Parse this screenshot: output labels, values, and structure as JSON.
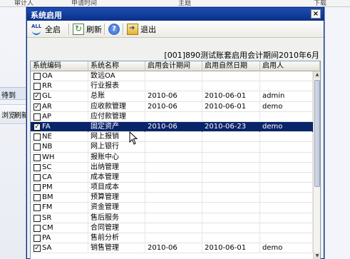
{
  "background": {
    "top_row": [
      "审计人",
      "申请时间",
      "主题",
      "下载"
    ],
    "side_tab": "待到",
    "strip": [
      "浏览",
      "刷新"
    ]
  },
  "dialog": {
    "title": "系统启用",
    "close_label": "×",
    "toolbar": {
      "all_label": "全启",
      "refresh_label": "刷新",
      "exit_label": "退出",
      "all_icon_text": "ALL",
      "help_icon_text": "?"
    },
    "period_text": "[001]890测试账套启用会计期间2010年6月",
    "columns": [
      "系统编码",
      "系统名称",
      "启用会计期间",
      "启用自然日期",
      "启用人"
    ],
    "rows": [
      {
        "checked": false,
        "code": "OA",
        "name": "致远OA",
        "period": "",
        "date": "",
        "user": ""
      },
      {
        "checked": false,
        "code": "RR",
        "name": "行业报表",
        "period": "",
        "date": "",
        "user": ""
      },
      {
        "checked": true,
        "code": "GL",
        "name": "总账",
        "period": "2010-06",
        "date": "2010-06-01",
        "user": "admin"
      },
      {
        "checked": true,
        "code": "AR",
        "name": "应收款管理",
        "period": "2010-06",
        "date": "2010-06-01",
        "user": "demo"
      },
      {
        "checked": false,
        "code": "AP",
        "name": "应付款管理",
        "period": "",
        "date": "",
        "user": ""
      },
      {
        "checked": true,
        "code": "FA",
        "name": "固定资产",
        "period": "2010-06",
        "date": "2010-06-23",
        "user": "demo",
        "selected": true
      },
      {
        "checked": false,
        "code": "NE",
        "name": "网上报销",
        "period": "",
        "date": "",
        "user": ""
      },
      {
        "checked": false,
        "code": "NB",
        "name": "网上银行",
        "period": "",
        "date": "",
        "user": ""
      },
      {
        "checked": false,
        "code": "WH",
        "name": "报账中心",
        "period": "",
        "date": "",
        "user": ""
      },
      {
        "checked": false,
        "code": "SC",
        "name": "出纳管理",
        "period": "",
        "date": "",
        "user": ""
      },
      {
        "checked": false,
        "code": "CA",
        "name": "成本管理",
        "period": "",
        "date": "",
        "user": ""
      },
      {
        "checked": false,
        "code": "PM",
        "name": "项目成本",
        "period": "",
        "date": "",
        "user": ""
      },
      {
        "checked": false,
        "code": "BM",
        "name": "预算管理",
        "period": "",
        "date": "",
        "user": ""
      },
      {
        "checked": false,
        "code": "FM",
        "name": "资金管理",
        "period": "",
        "date": "",
        "user": ""
      },
      {
        "checked": false,
        "code": "SR",
        "name": "售后服务",
        "period": "",
        "date": "",
        "user": ""
      },
      {
        "checked": false,
        "code": "CM",
        "name": "合同管理",
        "period": "",
        "date": "",
        "user": ""
      },
      {
        "checked": false,
        "code": "PA",
        "name": "售前分析",
        "period": "",
        "date": "",
        "user": ""
      },
      {
        "checked": true,
        "code": "SA",
        "name": "销售管理",
        "period": "2010-06",
        "date": "2010-06-01",
        "user": "demo"
      }
    ]
  }
}
